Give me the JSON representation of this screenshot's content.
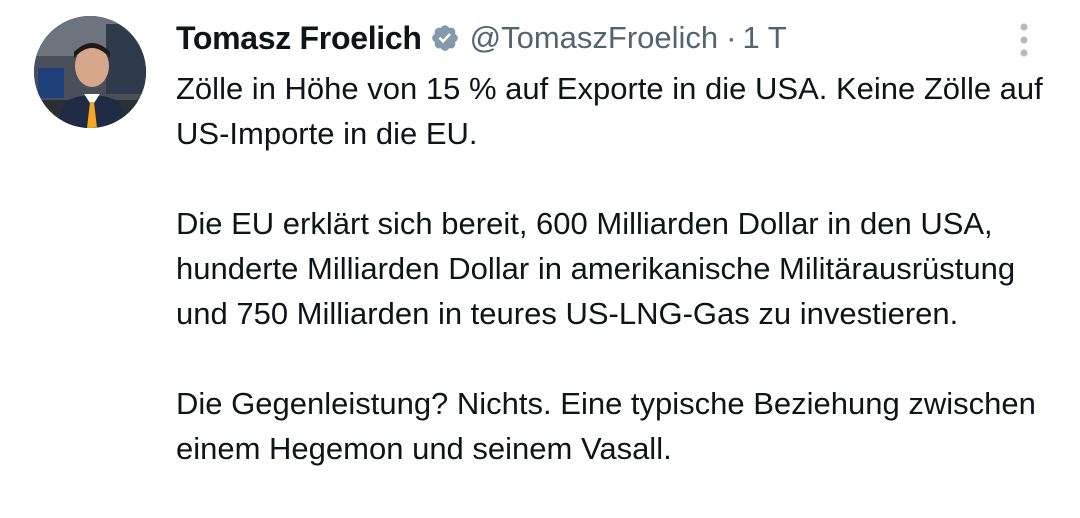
{
  "tweet": {
    "author": {
      "display_name": "Tomasz Froelich",
      "handle": "@TomaszFroelich",
      "verified": true,
      "avatar_icon": "profile-photo"
    },
    "separator": "·",
    "timestamp": "1 T",
    "more_icon": "more-vertical-icon",
    "paragraphs": [
      "Zölle in Höhe von 15 % auf Exporte in die USA. Keine Zölle auf US-Importe in die EU.",
      "Die EU erklärt sich bereit, 600 Milliarden Dollar in den USA, hunderte Milliarden Dollar in amerikanische Militärausrüstung und 750 Milliarden in teures US-LNG-Gas zu investieren.",
      "Die Gegenleistung? Nichts. Eine typische Beziehung zwischen einem Hegemon und seinem Vasall."
    ]
  },
  "colors": {
    "text_primary": "#0f1419",
    "text_secondary": "#536471",
    "verified_badge": "#829aab"
  }
}
